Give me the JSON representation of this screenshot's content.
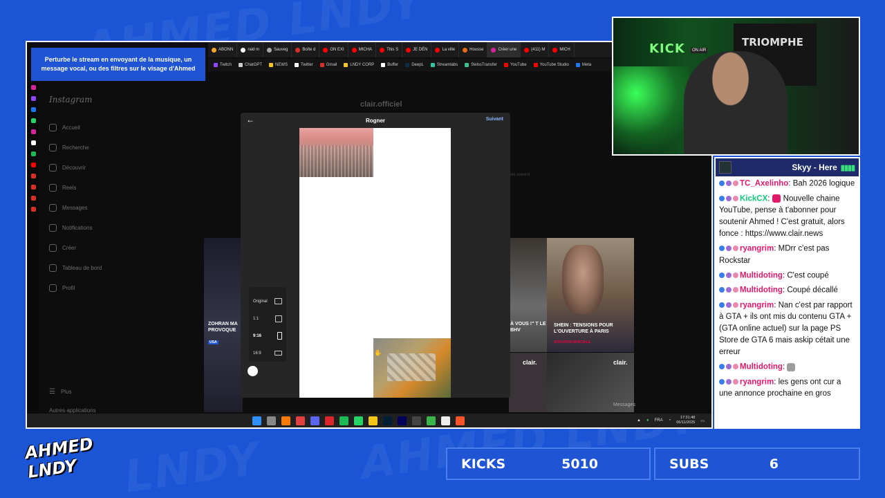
{
  "promo": {
    "text": "Perturbe le stream en envoyant de la musique, un message vocal, ou des filtres sur le visage d'Ahmed"
  },
  "browser": {
    "tabs": [
      {
        "label": "ABONN",
        "color": "#f5a623"
      },
      {
        "label": "raid m",
        "color": "#ffffff"
      },
      {
        "label": "Sauveg",
        "color": "#aaaaaa"
      },
      {
        "label": "Boîte d",
        "color": "#d93025"
      },
      {
        "label": "ON EXI",
        "color": "#ff0000"
      },
      {
        "label": "MICHA",
        "color": "#ff0000"
      },
      {
        "label": "This S",
        "color": "#ff0000"
      },
      {
        "label": "JE DÉN",
        "color": "#ff0000"
      },
      {
        "label": "La ville",
        "color": "#ff0000"
      },
      {
        "label": "Housse",
        "color": "#e86a1a"
      },
      {
        "label": "Créer une",
        "color": "#d6249f",
        "active": true
      },
      {
        "label": "(411) M",
        "color": "#ff0000"
      },
      {
        "label": "MICH",
        "color": "#ff0000"
      }
    ],
    "bookmarks": [
      {
        "label": "Twitch",
        "color": "#9146ff"
      },
      {
        "label": "ChatGPT",
        "color": "#cccccc"
      },
      {
        "label": "NEWS",
        "color": "#f5c518"
      },
      {
        "label": "Twitter",
        "color": "#ffffff"
      },
      {
        "label": "Gmail",
        "color": "#d93025"
      },
      {
        "label": "LNDY CORP",
        "color": "#f5c518"
      },
      {
        "label": "Buffer",
        "color": "#ffffff"
      },
      {
        "label": "DeepL",
        "color": "#0f2b46"
      },
      {
        "label": "Streamlabs",
        "color": "#31c3a2"
      },
      {
        "label": "SwissTransfer",
        "color": "#3ebf8f"
      },
      {
        "label": "YouTube",
        "color": "#ff0000"
      },
      {
        "label": "YouTube Studio",
        "color": "#ff0000"
      },
      {
        "label": "Meta",
        "color": "#1877f2"
      }
    ]
  },
  "instagram": {
    "logo": "Instagram",
    "nav": [
      {
        "label": "Accueil",
        "icon": "home-icon"
      },
      {
        "label": "Recherche",
        "icon": "search-icon"
      },
      {
        "label": "Découvrir",
        "icon": "compass-icon"
      },
      {
        "label": "Reels",
        "icon": "reels-icon"
      },
      {
        "label": "Messages",
        "icon": "messenger-icon"
      },
      {
        "label": "Notifications",
        "icon": "heart-icon"
      },
      {
        "label": "Créer",
        "icon": "plus-icon"
      },
      {
        "label": "Tableau de bord",
        "icon": "dashboard-icon"
      },
      {
        "label": "Profil",
        "icon": "avatar-icon"
      }
    ],
    "more": "Plus",
    "other_apps": "Autres applications",
    "profile_name": "clair.officiel",
    "followers_fragment": "nes suivent",
    "messages_label": "Messages"
  },
  "crop_modal": {
    "title": "Rogner",
    "next": "Suivant",
    "ratios": [
      {
        "label": "Original",
        "selected": false
      },
      {
        "label": "1:1",
        "selected": false
      },
      {
        "label": "9:16",
        "selected": true
      },
      {
        "label": "16:9",
        "selected": false
      }
    ]
  },
  "posts": [
    {
      "title": "ZOHRAN MA PROVOQUE",
      "tag": "USA"
    },
    {
      "title": "À VOUS !\" T LE BHV",
      "tag": ""
    },
    {
      "title": "SHEIN : TENSIONS POUR L'OUVERTURE À PARIS",
      "tag": "SITUATION SPÉCIALE"
    },
    {
      "title": "clair.",
      "tag": ""
    },
    {
      "title": "clair.",
      "tag": ""
    }
  ],
  "taskbar": {
    "lang": "FRA",
    "time": "17:31:48",
    "date": "06/11/2025"
  },
  "webcam": {
    "kick_sign": "KICK",
    "on_air": "ON AIR",
    "banner": "TRIOMPHE"
  },
  "chat": {
    "header": "Skyy - Here",
    "messages": [
      {
        "user": "TC_Axelinho",
        "color": "#e0196b",
        "text": "Bah 2026 logique",
        "emote": ""
      },
      {
        "user": "KickCX",
        "color": "#14c97d",
        "text": "Nouvelle chaine YouTube, pense à t'abonner pour soutenir Ahmed ! C'est gratuit, alors fonce : https://www.clair.news",
        "emote": "youtube-emote"
      },
      {
        "user": "ryangrim",
        "color": "#e0196b",
        "text": "MDrr c'est pas Rockstar",
        "emote": ""
      },
      {
        "user": "Multidoting",
        "color": "#e0196b",
        "text": "C'est coupé",
        "emote": ""
      },
      {
        "user": "Multidoting",
        "color": "#e0196b",
        "text": "Coupé décallé",
        "emote": ""
      },
      {
        "user": "ryangrim",
        "color": "#e0196b",
        "text": "Nan c'est par rapport à GTA + ils ont mis du contenu GTA + (GTA online actuel) sur la page PS Store de GTA 6 mais askip cétait une erreur",
        "emote": ""
      },
      {
        "user": "Multidoting",
        "color": "#e0196b",
        "text": "",
        "emote": "cat-emote"
      },
      {
        "user": "ryangrim",
        "color": "#e0196b",
        "text": "les gens ont cur a une annonce prochaine en gros",
        "emote": ""
      }
    ]
  },
  "overlay": {
    "logo": "AHMED LNDY",
    "kicks_label": "KICKS",
    "kicks_value": "5010",
    "subs_label": "SUBS",
    "subs_value": "6"
  }
}
